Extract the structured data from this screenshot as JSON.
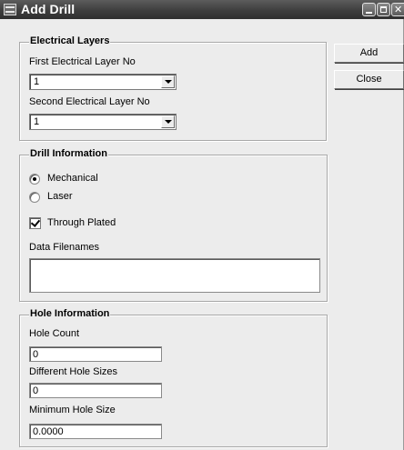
{
  "window": {
    "title": "Add Drill"
  },
  "electrical_layers": {
    "title": "Electrical Layers",
    "first_label": "First Electrical Layer No",
    "first_value": "1",
    "second_label": "Second Electrical Layer No",
    "second_value": "1"
  },
  "drill_information": {
    "title": "Drill Information",
    "drill_type_options": [
      "Mechanical",
      "Laser"
    ],
    "selected_drill_type": "Mechanical",
    "through_plated_label": "Through Plated",
    "through_plated_checked": true,
    "data_filenames_label": "Data Filenames",
    "data_filenames_value": ""
  },
  "hole_information": {
    "title": "Hole Information",
    "hole_count_label": "Hole Count",
    "hole_count_value": "0",
    "different_sizes_label": "Different Hole Sizes",
    "different_sizes_value": "0",
    "min_size_label": "Minimum Hole Size",
    "min_size_value": "0.0000"
  },
  "buttons": {
    "add": "Add",
    "close": "Close"
  },
  "icons": [
    "app-icon",
    "minimize-icon",
    "maximize-icon",
    "close-icon",
    "dropdown-arrow-icon"
  ]
}
